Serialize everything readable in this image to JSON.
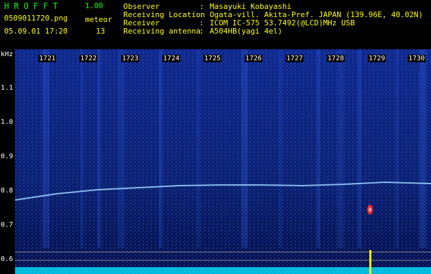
{
  "app": {
    "title": "HROFFT",
    "version": "1.00"
  },
  "file": {
    "name": "0509011720.png",
    "datetime": "05.09.01 17:20"
  },
  "meteor": {
    "label": "meteor",
    "count": "13"
  },
  "info": [
    {
      "key": "Observer",
      "value": "Masayuki Kobayashi"
    },
    {
      "key": "Receiving Location",
      "value": "Ogata-vill. Akita-Pref. JAPAN (139.96E, 40.02N)"
    },
    {
      "key": "Receiver",
      "value": "ICOM IC-575 53.7492(@LCD)MHz USB"
    },
    {
      "key": "Receiving antenna",
      "value": "A504HB(yagi 4el)"
    }
  ],
  "spectrogram": {
    "unit": "kHz",
    "y_ticks": [
      "1.1",
      "1.0",
      "0.9",
      "0.8",
      "0.7",
      "0.6"
    ],
    "time_ticks": [
      "1721",
      "1722",
      "1723",
      "1724",
      "1725",
      "1726",
      "1727",
      "1728",
      "1729",
      "1730"
    ],
    "colors": {
      "background": "#000033",
      "noise": "#1f4fd6",
      "carrier": "#9fd8ff",
      "meteor": "#ff2a2a",
      "baseline": "#00e5ff",
      "spike": "#ffff00"
    }
  }
}
